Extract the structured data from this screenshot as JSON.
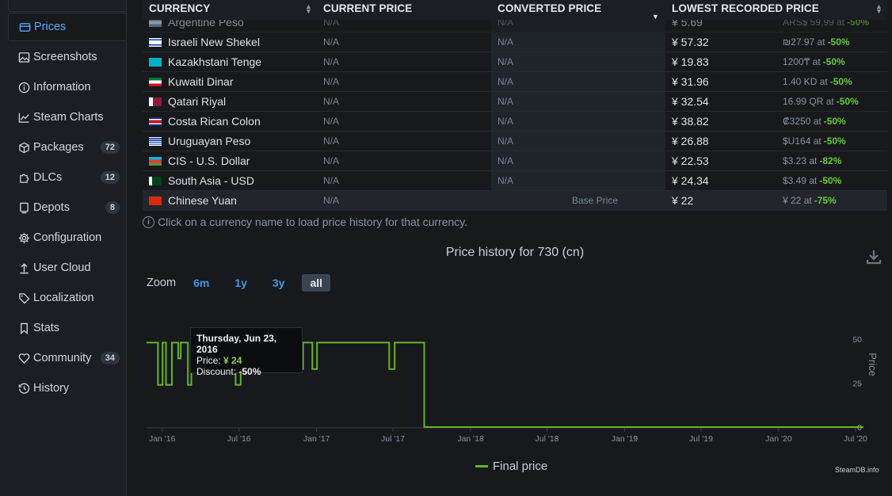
{
  "sidebar": {
    "items": [
      {
        "label": "Prices",
        "icon": "prices-card-icon",
        "active": true
      },
      {
        "label": "Screenshots",
        "icon": "image-icon"
      },
      {
        "label": "Information",
        "icon": "info-icon"
      },
      {
        "label": "Steam Charts",
        "icon": "line-chart-icon"
      },
      {
        "label": "Packages",
        "icon": "package-icon",
        "badge": "72"
      },
      {
        "label": "DLCs",
        "icon": "dlc-puzzle-icon",
        "badge": "12"
      },
      {
        "label": "Depots",
        "icon": "depot-drive-icon",
        "badge": "8"
      },
      {
        "label": "Configuration",
        "icon": "gear-icon"
      },
      {
        "label": "User Cloud",
        "icon": "upload-icon"
      },
      {
        "label": "Localization",
        "icon": "tag-icon"
      },
      {
        "label": "Stats",
        "icon": "bookmark-icon"
      },
      {
        "label": "Community",
        "icon": "heart-icon",
        "badge": "34"
      },
      {
        "label": "History",
        "icon": "history-icon"
      }
    ]
  },
  "table": {
    "headers": [
      "CURRENCY",
      "CURRENT PRICE",
      "CONVERTED PRICE",
      "LOWEST RECORDED PRICE"
    ],
    "rows": [
      {
        "currency": "Argentine Peso",
        "current": "N/A",
        "converted": "N/A",
        "lowest": "¥ 5.69",
        "lowest_local": "ARS$ 59,99 at",
        "discount": "-50%",
        "flag": "ar",
        "clipped": true
      },
      {
        "currency": "Israeli New Shekel",
        "current": "N/A",
        "converted": "N/A",
        "lowest": "¥ 57.32",
        "lowest_local": "₪27.97 at",
        "discount": "-50%",
        "flag": "il"
      },
      {
        "currency": "Kazakhstani Tenge",
        "current": "N/A",
        "converted": "N/A",
        "lowest": "¥ 19.83",
        "lowest_local": "1200₸ at",
        "discount": "-50%",
        "flag": "kz"
      },
      {
        "currency": "Kuwaiti Dinar",
        "current": "N/A",
        "converted": "N/A",
        "lowest": "¥ 31.96",
        "lowest_local": "1.40 KD at",
        "discount": "-50%",
        "flag": "kw"
      },
      {
        "currency": "Qatari Riyal",
        "current": "N/A",
        "converted": "N/A",
        "lowest": "¥ 32.54",
        "lowest_local": "16.99 QR at",
        "discount": "-50%",
        "flag": "qa"
      },
      {
        "currency": "Costa Rican Colon",
        "current": "N/A",
        "converted": "N/A",
        "lowest": "¥ 38.82",
        "lowest_local": "₡3250 at",
        "discount": "-50%",
        "flag": "cr"
      },
      {
        "currency": "Uruguayan Peso",
        "current": "N/A",
        "converted": "N/A",
        "lowest": "¥ 26.88",
        "lowest_local": "$U164 at",
        "discount": "-50%",
        "flag": "uy"
      },
      {
        "currency": "CIS - U.S. Dollar",
        "current": "N/A",
        "converted": "N/A",
        "lowest": "¥ 22.53",
        "lowest_local": "$3.23 at",
        "discount": "-82%",
        "flag": "az"
      },
      {
        "currency": "South Asia - USD",
        "current": "N/A",
        "converted": "N/A",
        "lowest": "¥ 24.34",
        "lowest_local": "$3.49 at",
        "discount": "-50%",
        "flag": "pk"
      },
      {
        "currency": "Chinese Yuan",
        "current": "N/A",
        "converted": "Base Price",
        "lowest": "¥ 22",
        "lowest_local": "¥ 22 at",
        "discount": "-75%",
        "flag": "cn",
        "base": true
      }
    ]
  },
  "note": "Click on a currency name to load price history for that currency.",
  "chart": {
    "title": "Price history for 730 (cn)",
    "zoom_label": "Zoom",
    "zoom_options": [
      "6m",
      "1y",
      "3y",
      "all"
    ],
    "zoom_selected": "all",
    "tooltip": {
      "date": "Thursday, Jun 23, 2016",
      "price_label": "Price:",
      "price_value": "¥ 24",
      "discount_label": "Discount:",
      "discount_value": "-50%"
    },
    "legend": "Final price",
    "credit": "SteamDB.info",
    "line_color": "#66b324"
  },
  "chart_data": {
    "type": "line",
    "title": "Price history for 730 (cn)",
    "ylabel": "Price",
    "ylim": [
      0,
      50
    ],
    "yticks": [
      0,
      25,
      50
    ],
    "xticks": [
      "Jan '16",
      "Jul '16",
      "Jan '17",
      "Jul '17",
      "Jan '18",
      "Jul '18",
      "Jan '19",
      "Jul '19",
      "Jan '20",
      "Jul '20"
    ],
    "series": [
      {
        "name": "Final price",
        "points": [
          [
            "2015-11-25",
            48
          ],
          [
            "2015-12-22",
            48
          ],
          [
            "2015-12-22",
            24
          ],
          [
            "2016-01-02",
            24
          ],
          [
            "2016-01-02",
            48
          ],
          [
            "2016-01-10",
            48
          ],
          [
            "2016-01-10",
            24
          ],
          [
            "2016-01-24",
            24
          ],
          [
            "2016-01-24",
            48
          ],
          [
            "2016-02-08",
            48
          ],
          [
            "2016-02-08",
            39
          ],
          [
            "2016-02-14",
            39
          ],
          [
            "2016-02-14",
            48
          ],
          [
            "2016-03-02",
            48
          ],
          [
            "2016-03-02",
            24
          ],
          [
            "2016-03-10",
            24
          ],
          [
            "2016-03-10",
            48
          ],
          [
            "2016-06-23",
            48
          ],
          [
            "2016-06-23",
            24
          ],
          [
            "2016-07-05",
            24
          ],
          [
            "2016-07-05",
            48
          ],
          [
            "2016-11-23",
            48
          ],
          [
            "2016-11-23",
            33
          ],
          [
            "2016-11-30",
            33
          ],
          [
            "2016-11-30",
            48
          ],
          [
            "2016-12-22",
            48
          ],
          [
            "2016-12-22",
            33
          ],
          [
            "2017-01-02",
            33
          ],
          [
            "2017-01-02",
            48
          ],
          [
            "2017-06-22",
            48
          ],
          [
            "2017-06-22",
            33
          ],
          [
            "2017-07-05",
            33
          ],
          [
            "2017-07-05",
            48
          ],
          [
            "2017-09-13",
            48
          ],
          [
            "2017-09-13",
            0
          ],
          [
            "2020-07-20",
            0
          ]
        ]
      }
    ],
    "legend_position": "bottom-center",
    "grid": false
  }
}
